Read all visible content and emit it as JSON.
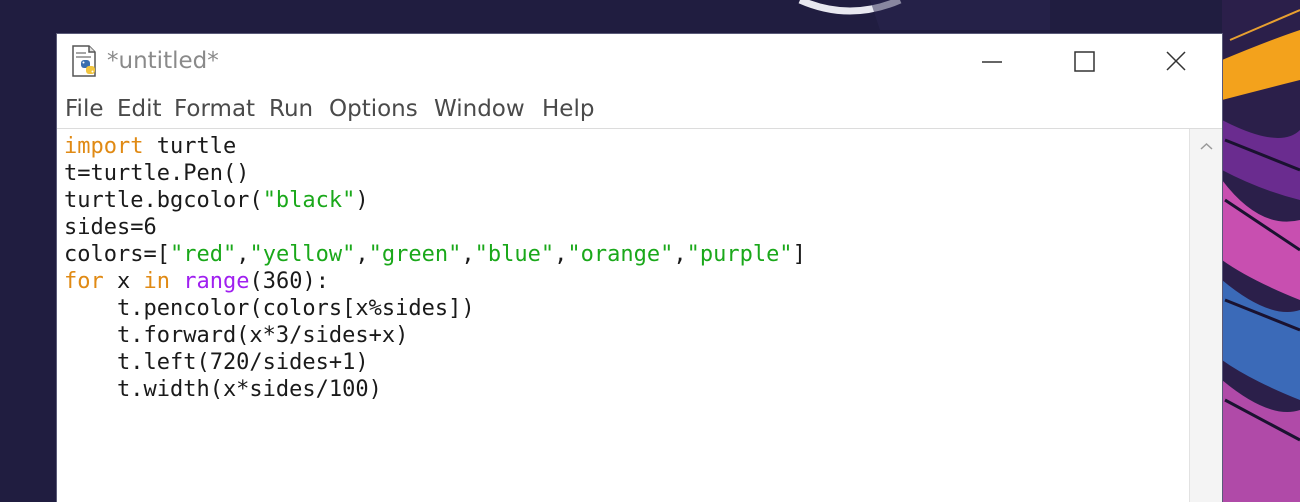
{
  "window": {
    "title": "*untitled*",
    "icon": "python-file-icon"
  },
  "titlebar_buttons": {
    "minimize_icon": "minimize-icon",
    "maximize_icon": "maximize-icon",
    "close_icon": "close-icon"
  },
  "menu": {
    "items": [
      {
        "label": "File"
      },
      {
        "label": "Edit"
      },
      {
        "label": "Format"
      },
      {
        "label": "Run"
      },
      {
        "label": "Options"
      },
      {
        "label": "Window"
      },
      {
        "label": "Help"
      }
    ]
  },
  "editor": {
    "lines": [
      [
        {
          "t": "import",
          "c": "kw"
        },
        {
          "t": " turtle",
          "c": "plain"
        }
      ],
      [
        {
          "t": "t=turtle.Pen()",
          "c": "plain"
        }
      ],
      [
        {
          "t": "turtle.bgcolor(",
          "c": "plain"
        },
        {
          "t": "\"black\"",
          "c": "str"
        },
        {
          "t": ")",
          "c": "plain"
        }
      ],
      [
        {
          "t": "sides=6",
          "c": "plain"
        }
      ],
      [
        {
          "t": "colors=[",
          "c": "plain"
        },
        {
          "t": "\"red\"",
          "c": "str"
        },
        {
          "t": ",",
          "c": "plain"
        },
        {
          "t": "\"yellow\"",
          "c": "str"
        },
        {
          "t": ",",
          "c": "plain"
        },
        {
          "t": "\"green\"",
          "c": "str"
        },
        {
          "t": ",",
          "c": "plain"
        },
        {
          "t": "\"blue\"",
          "c": "str"
        },
        {
          "t": ",",
          "c": "plain"
        },
        {
          "t": "\"orange\"",
          "c": "str"
        },
        {
          "t": ",",
          "c": "plain"
        },
        {
          "t": "\"purple\"",
          "c": "str"
        },
        {
          "t": "]",
          "c": "plain"
        }
      ],
      [
        {
          "t": "for",
          "c": "kw"
        },
        {
          "t": " x ",
          "c": "plain"
        },
        {
          "t": "in",
          "c": "kw"
        },
        {
          "t": " ",
          "c": "plain"
        },
        {
          "t": "range",
          "c": "bi"
        },
        {
          "t": "(360):",
          "c": "plain"
        }
      ],
      [
        {
          "t": "    t.pencolor(colors[x%sides])",
          "c": "plain"
        }
      ],
      [
        {
          "t": "    t.forward(x*3/sides+x)",
          "c": "plain"
        }
      ],
      [
        {
          "t": "    t.left(720/sides+1)",
          "c": "plain"
        }
      ],
      [
        {
          "t": "    t.width(x*sides/100)",
          "c": "plain"
        }
      ]
    ]
  },
  "scrollbar": {
    "up_icon": "chevron-up-icon"
  },
  "colors": {
    "keyword": "#e08a14",
    "builtin": "#a020f0",
    "string": "#1aa81a",
    "text": "#1a1a1a",
    "title_text": "#8a8a8a",
    "desktop": "#201d40"
  }
}
